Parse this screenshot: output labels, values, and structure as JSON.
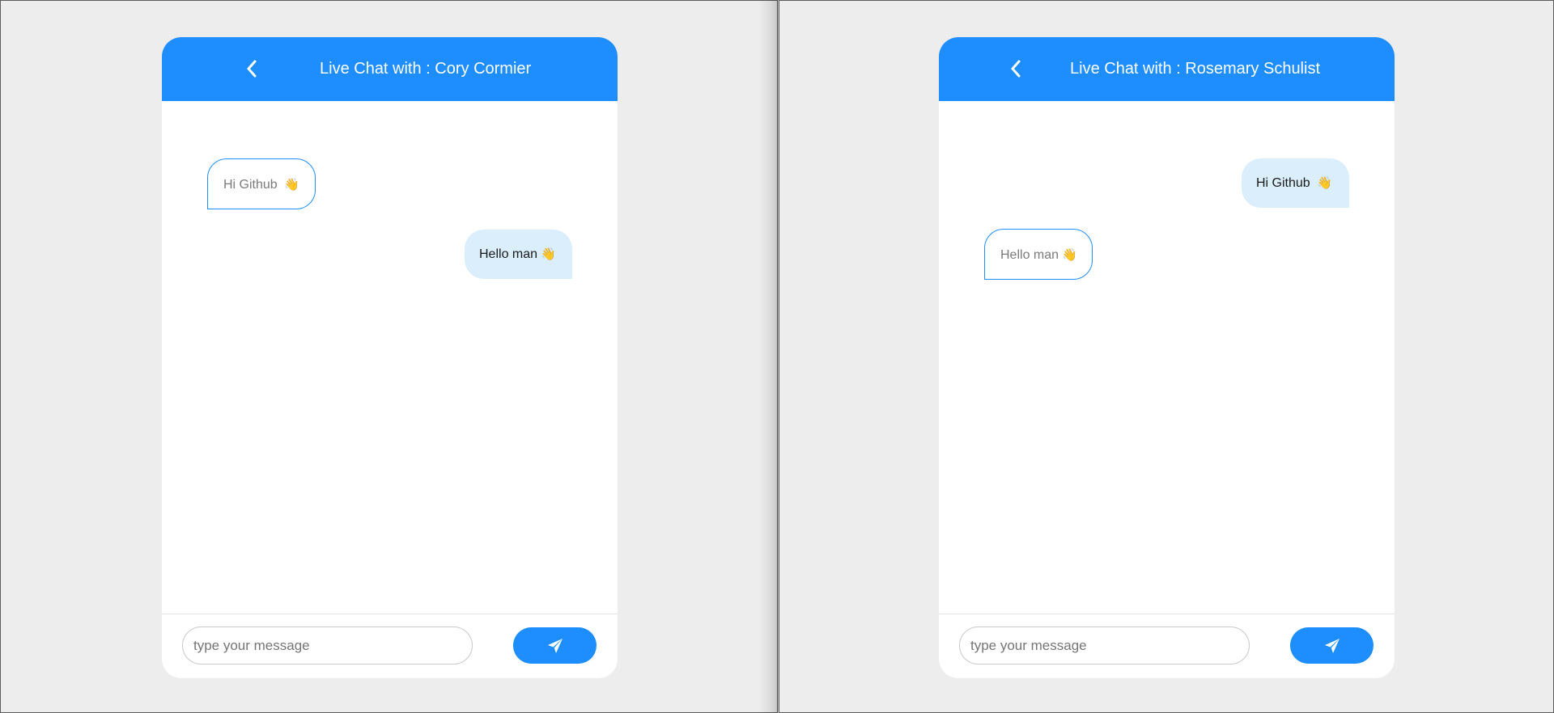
{
  "panels": [
    {
      "header": {
        "title": "Live Chat with : Cory Cormier",
        "back_icon": "chevron-left-icon"
      },
      "messages": [
        {
          "direction": "received",
          "text": "Hi Github",
          "emoji": "👋"
        },
        {
          "direction": "sent",
          "text": "Hello man",
          "emoji": "👋"
        }
      ],
      "composer": {
        "placeholder": "type your message",
        "value": "",
        "send_icon": "paper-plane-icon"
      }
    },
    {
      "header": {
        "title": "Live Chat with : Rosemary Schulist",
        "back_icon": "chevron-left-icon"
      },
      "messages": [
        {
          "direction": "sent",
          "text": "Hi Github",
          "emoji": "👋"
        },
        {
          "direction": "received",
          "text": "Hello man",
          "emoji": "👋"
        }
      ],
      "composer": {
        "placeholder": "type your message",
        "value": "",
        "send_icon": "paper-plane-icon"
      }
    }
  ],
  "colors": {
    "accent": "#1e8dfe",
    "sent_bubble": "#daeefc",
    "background": "#ececec",
    "card": "#ffffff"
  }
}
